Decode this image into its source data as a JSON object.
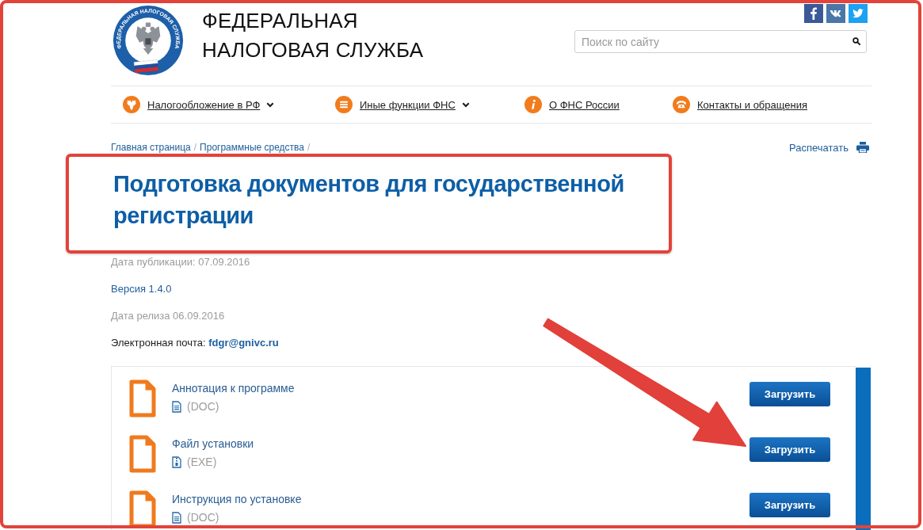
{
  "annotation_frame": true,
  "logo": {
    "ring_text": "ФЕДЕРАЛЬНАЯ НАЛОГОВАЯ СЛУЖБА",
    "title_lines": [
      "ФЕДЕРАЛЬНАЯ",
      "НАЛОГОВАЯ СЛУЖБА"
    ]
  },
  "search": {
    "placeholder": "Поиск по сайту"
  },
  "nav": [
    {
      "label": "Налогообложение в РФ",
      "dropdown": true
    },
    {
      "label": "Иные функции ФНС",
      "dropdown": true
    },
    {
      "label": "О ФНС России",
      "dropdown": false
    },
    {
      "label": "Контакты и обращения",
      "dropdown": false
    }
  ],
  "breadcrumb": {
    "separator": "/",
    "items": [
      "Главная страница",
      "Программные средства"
    ]
  },
  "print_link": "Распечатать",
  "title": {
    "text": "Подготовка документов для государственной регистрации",
    "highlighted": true
  },
  "meta": [
    {
      "kind": "date",
      "text": "Дата публикации: 07.09.2016"
    },
    {
      "kind": "link",
      "text": "Версия 1.4.0"
    },
    {
      "kind": "date",
      "text": "Дата релиза 06.09.2016"
    },
    {
      "kind": "email",
      "label": "Электронная почта:",
      "link": "fdgr@gnivc.ru"
    }
  ],
  "files": [
    {
      "title": "Аннотация к программе",
      "kind": "doc",
      "format": "(DOC)",
      "button": "Загрузить",
      "arrow": false
    },
    {
      "title": "Файл установки",
      "kind": "archive",
      "format": "(EXE)",
      "button": "Загрузить",
      "arrow": true
    },
    {
      "title": "Инструкция по установке",
      "kind": "doc",
      "format": "(DOC)",
      "button": "Загрузить",
      "arrow": false
    }
  ]
}
